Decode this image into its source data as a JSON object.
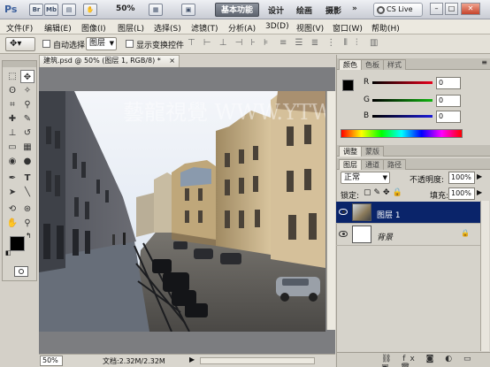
{
  "app": {
    "logo": "Ps",
    "zoom": "50%",
    "workspace": "基本功能",
    "design": "设计",
    "paint": "绘画",
    "photo": "摄影",
    "more": "»",
    "cslive": "CS Live"
  },
  "menu": [
    "文件(F)",
    "编辑(E)",
    "图像(I)",
    "图层(L)",
    "选择(S)",
    "滤镜(T)",
    "分析(A)",
    "3D(D)",
    "视图(V)",
    "窗口(W)",
    "帮助(H)"
  ],
  "options": {
    "auto_select_label": "自动选择:",
    "auto_select_value": "图层",
    "show_transform_label": "显示变换控件"
  },
  "document": {
    "tab": "建筑.psd @ 50% (图层 1, RGB/8) *",
    "close": "×"
  },
  "status": {
    "zoom": "50%",
    "doc_size": "文档:2.32M/2.32M"
  },
  "color_panel": {
    "tabs": [
      "颜色",
      "色板",
      "样式"
    ],
    "labels": [
      "R",
      "G",
      "B"
    ],
    "values": [
      "0",
      "0",
      "0"
    ],
    "accent_r": "#e8001c",
    "accent_g": "#11b511",
    "accent_b": "#1b1bd8"
  },
  "adjust_panel": {
    "tabs": [
      "调整",
      "蒙版"
    ]
  },
  "layers_panel": {
    "tabs": [
      "图层",
      "通道",
      "路径"
    ],
    "blend_mode": "正常",
    "opacity_label": "不透明度:",
    "opacity_value": "100%",
    "lock_label": "锁定:",
    "fill_label": "填充:",
    "fill_value": "100%",
    "layers": [
      {
        "name": "图层 1",
        "selected": true
      },
      {
        "name": "背景",
        "selected": false
      }
    ]
  },
  "watermark": "藝龍視覺 WWW.YTWLW.NET",
  "icons": {
    "move": "move-tool-icon",
    "eye": "eye-icon",
    "lock": "lock-icon"
  }
}
